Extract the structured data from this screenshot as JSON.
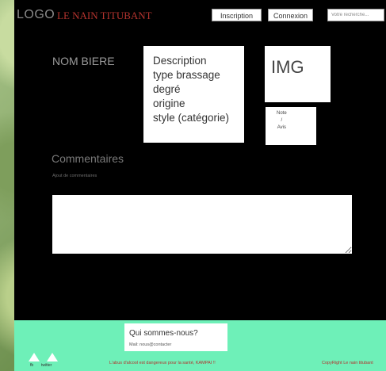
{
  "header": {
    "logo": "LOGO",
    "brand": "LE NAIN TITUBANT",
    "inscription": "Inscription",
    "connexion": "Connexion",
    "search_placeholder": "Votre recherche..."
  },
  "beer": {
    "name": "NOM BIERE",
    "description_lines": [
      "Description",
      "type brassage",
      "degré",
      "origine",
      "style (catégorie)"
    ],
    "image_label": "IMG",
    "note": "Note",
    "slash": "/",
    "avis": "Avis"
  },
  "comments": {
    "title": "Commentaires",
    "subtitle": "Ajout de commentaires",
    "input_value": ""
  },
  "footer": {
    "about_title": "Qui sommes-nous?",
    "about_mail": "Mail: nous@contacter",
    "social": [
      "fb",
      "twitter"
    ],
    "warning": "L'abus d'alcool est dangereux pour la santé, KAMPAI !!",
    "copyright": "CopyRight Le nain titubant"
  }
}
